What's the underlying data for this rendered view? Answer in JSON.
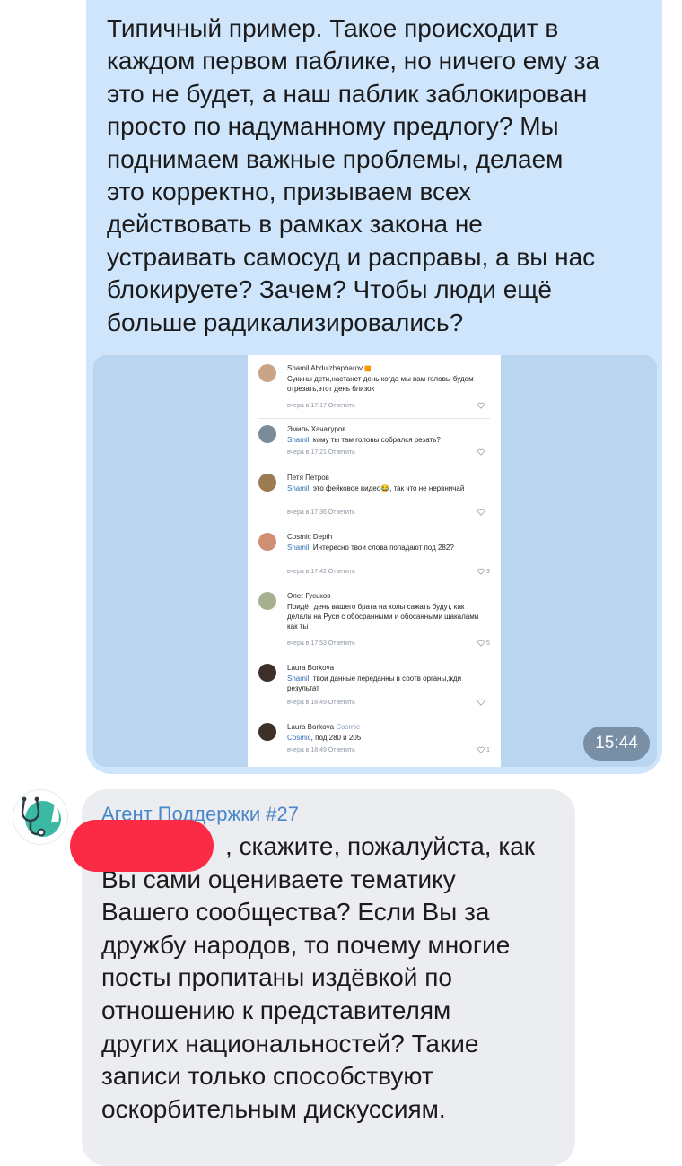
{
  "outgoing": {
    "text": "Типичный пример. Такое происходит в\nкаждом первом паблике, но ничего ему за\nэто не будет, а наш паблик заблокирован\nпросто по надуманному предлогу? Мы\nподнимаем важные проблемы, делаем\nэто корректно, призываем всех\nдействовать в рамках закона не\nустраивать самосуд и расправы, а вы нас\nблокируете? Зачем? Чтобы люди ещё\nбольше радикализировались?",
    "time": "15:44",
    "screenshot": {
      "comments": [
        {
          "name": "Shamil Abdulzhapbarov",
          "badge": "🟧",
          "body": "Сукины дети,настанет день когда мы вам головы будем отрезать,этот день близок",
          "meta": "вчера в 17:17   Ответить",
          "likes": ""
        },
        {
          "name": "Эмиль Хачатуров",
          "mention": "Shamil",
          "body": ", кому ты там головы собрался резать?",
          "meta": "вчера в 17:21   Ответить",
          "likes": ""
        },
        {
          "name": "Петя Петров",
          "mention": "Shamil",
          "body": ", это фейковое видео😂, так что не нервничай",
          "meta": "вчера в 17:36   Ответить",
          "likes": ""
        },
        {
          "name": "Cosmic Depth",
          "mention": "Shamil",
          "body": ", Интересно твои слова попадают под 282?",
          "meta": "вчера в 17:42   Ответить",
          "likes": "3"
        },
        {
          "name": "Олег Гуськов",
          "body": "Придёт день вашего брата на колы сажать будут, как делали на Руси с обосранными и обосанными шакалами как ты",
          "meta": "вчера в 17:53   Ответить",
          "likes": "5"
        },
        {
          "name": "Laura Borkova",
          "mention": "Shamil",
          "body": ", твои данные переданны в соотв органы,жди результат",
          "meta": "вчера в 18:49   Ответить",
          "likes": ""
        },
        {
          "name": "Laura Borkova",
          "tag": "Cosmic",
          "mention": "Cosmic",
          "body": ", под 280 и 205",
          "meta": "вчера в 18:49   Ответить",
          "likes": "1"
        }
      ]
    }
  },
  "incoming": {
    "sender": "Агент Поддержки #27",
    "text": ", скажите, пожалуйста, как\nВы сами оцениваете тематику\nВашего сообщества? Если Вы за\nдружбу народов, то почему многие\nпосты пропитаны издёвкой по\nотношению к представителям\nдругих национальностей? Такие\nзаписи только способствуют\nоскорбительным дискуссиям."
  },
  "colors": {
    "outgoing_bubble": "#cfe5fc",
    "incoming_bubble": "#ebedf1",
    "sender_name": "#4a87c8",
    "redaction": "#fc2b45",
    "mention": "#2f71b8"
  }
}
